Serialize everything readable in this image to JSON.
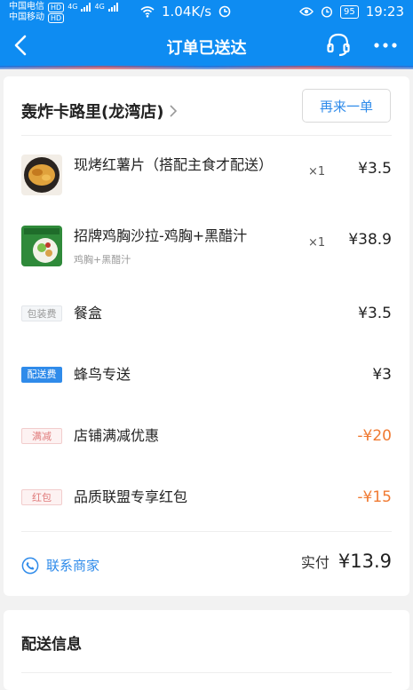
{
  "status_bar": {
    "carrier1": "中国电信",
    "carrier2": "中国移动",
    "hd": "HD",
    "net1": "4G",
    "net2": "4G",
    "speed": "1.04K/s",
    "battery": "95",
    "time": "19:23"
  },
  "nav": {
    "title": "订单已送达"
  },
  "shop": {
    "name": "轰炸卡路里(龙湾店)",
    "reorder_label": "再来一单"
  },
  "items": [
    {
      "name": "现烤红薯片（搭配主食才配送）",
      "sub": "",
      "qty": "×1",
      "price": "¥3.5"
    },
    {
      "name": "招牌鸡胸沙拉-鸡胸+黑醋汁",
      "sub": "鸡胸+黑醋汁",
      "qty": "×1",
      "price": "¥38.9"
    }
  ],
  "fees": [
    {
      "tag": "包装费",
      "label": "餐盒",
      "value": "¥3.5"
    },
    {
      "tag": "配送费",
      "label": "蜂鸟专送",
      "value": "¥3"
    },
    {
      "tag": "满减",
      "label": "店铺满减优惠",
      "value": "-¥20"
    },
    {
      "tag": "红包",
      "label": "品质联盟专享红包",
      "value": "-¥15"
    }
  ],
  "footer": {
    "contact_label": "联系商家",
    "total_label": "实付",
    "total_value": "¥13.9"
  },
  "delivery": {
    "title": "配送信息"
  },
  "colors": {
    "brand_blue": "#0e8cf2",
    "link_blue": "#2f8bea",
    "discount_orange": "#f07a32"
  }
}
